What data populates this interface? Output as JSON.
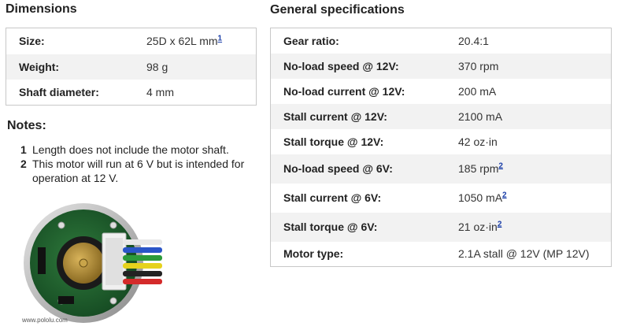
{
  "dimensions": {
    "title": "Dimensions",
    "rows": [
      {
        "label": "Size:",
        "value": "25D x 62L mm",
        "ref": "1"
      },
      {
        "label": "Weight:",
        "value": "98 g",
        "ref": ""
      },
      {
        "label": "Shaft diameter:",
        "value": "4 mm",
        "ref": ""
      }
    ]
  },
  "general": {
    "title": "General specifications",
    "rows": [
      {
        "label": "Gear ratio:",
        "value": "20.4:1",
        "ref": ""
      },
      {
        "label": "No-load speed @ 12V:",
        "value": "370 rpm",
        "ref": ""
      },
      {
        "label": "No-load current @ 12V:",
        "value": "200 mA",
        "ref": ""
      },
      {
        "label": "Stall current @ 12V:",
        "value": "2100 mA",
        "ref": ""
      },
      {
        "label": "Stall torque @ 12V:",
        "value": "42 oz·in",
        "ref": ""
      },
      {
        "label": "No-load speed @ 6V:",
        "value": "185 rpm",
        "ref": "2"
      },
      {
        "label": "Stall current @ 6V:",
        "value": "1050 mA",
        "ref": "2"
      },
      {
        "label": "Stall torque @ 6V:",
        "value": "21 oz·in",
        "ref": "2"
      },
      {
        "label": "Motor type:",
        "value": "2.1A stall @ 12V (MP 12V)",
        "ref": ""
      }
    ]
  },
  "notes": {
    "title": "Notes:",
    "items": [
      {
        "num": "1",
        "text": "Length does not include the motor shaft."
      },
      {
        "num": "2",
        "text": "This motor will run at 6 V but is intended for operation at 12 V."
      }
    ]
  },
  "image": {
    "watermark": "www.pololu.com",
    "wire_colors": [
      "#e8e8e8",
      "#2a55c8",
      "#2b9a3a",
      "#e6d21d",
      "#222222",
      "#d42a2a"
    ]
  }
}
